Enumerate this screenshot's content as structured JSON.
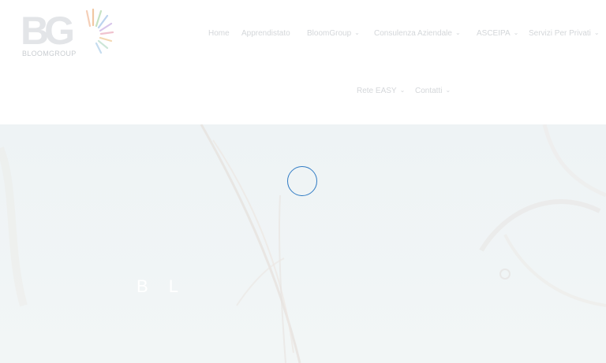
{
  "brand": {
    "logo_letters": "BG",
    "logo_text": "BLOOMGROUP"
  },
  "nav": {
    "items": [
      {
        "label": "Home",
        "has_dropdown": false
      },
      {
        "label": "Apprendistato",
        "has_dropdown": false
      },
      {
        "label": "BloomGroup",
        "has_dropdown": true
      },
      {
        "label": "Consulenza Aziendale",
        "has_dropdown": true
      },
      {
        "label": "ASCEIPA",
        "has_dropdown": true
      },
      {
        "label": "Servizi Per Privati",
        "has_dropdown": true
      },
      {
        "label": "Rete EASY",
        "has_dropdown": true
      },
      {
        "label": "Contatti",
        "has_dropdown": true
      }
    ],
    "chevron": "⌵"
  },
  "hero": {
    "title": "B L",
    "spinner_color": "#1c6fbf"
  },
  "colors": {
    "nav_text": "#d4d7da",
    "hero_bg": "#eef3f5"
  }
}
